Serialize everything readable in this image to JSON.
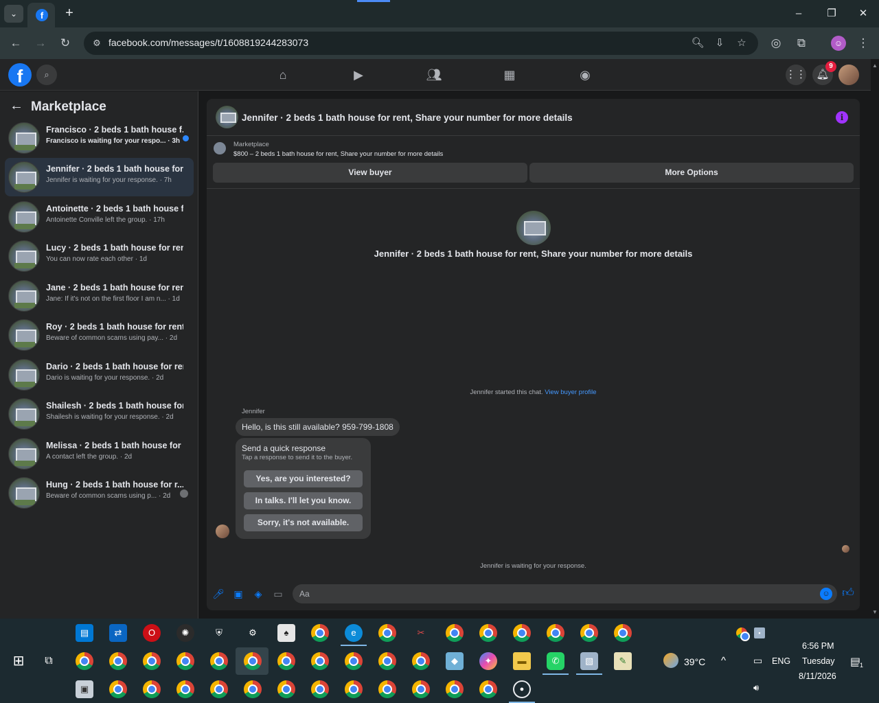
{
  "browser": {
    "url": "facebook.com/messages/t/1608819244283073",
    "new_tab_label": "+",
    "profile_initial": "☺"
  },
  "fbnav": {
    "notification_count": "9"
  },
  "sidebar": {
    "title": "Marketplace",
    "conversations": [
      {
        "title": "Francisco · 2 beds 1 bath house f...",
        "subtitle": "Francisco is waiting for your respo... · 3h",
        "unread": true
      },
      {
        "title": "Jennifer · 2 beds 1 bath house for r...",
        "subtitle": "Jennifer is waiting for your response. · 7h",
        "active": true
      },
      {
        "title": "Antoinette · 2 beds 1 bath house f...",
        "subtitle": "Antoinette Conville left the group. · 17h"
      },
      {
        "title": "Lucy · 2 beds 1 bath house for rent...",
        "subtitle": "You can now rate each other · 1d"
      },
      {
        "title": "Jane · 2 beds 1 bath house for rent...",
        "subtitle": "Jane: If it's not on the first floor I am n... · 1d"
      },
      {
        "title": "Roy · 2 beds 1 bath house for rent, ...",
        "subtitle": "Beware of common scams using pay... · 2d"
      },
      {
        "title": "Dario · 2 beds 1 bath house for ren...",
        "subtitle": "Dario is waiting for your response. · 2d"
      },
      {
        "title": "Shailesh · 2 beds 1 bath house for ...",
        "subtitle": "Shailesh is waiting for your response. · 2d"
      },
      {
        "title": "Melissa · 2 beds 1 bath house for r...",
        "subtitle": "A contact left the group. · 2d"
      },
      {
        "title": "Hung · 2 beds 1 bath house for r...",
        "subtitle": "Beware of common scams using p... · 2d"
      }
    ]
  },
  "chat": {
    "header_title": "Jennifer · 2 beds 1 bath house for rent, Share your number for more details",
    "listing_label": "Marketplace",
    "listing_price": "$800 – 2 beds 1 bath house for rent, Share your number for more details",
    "view_buyer_label": "View buyer",
    "more_options_label": "More Options",
    "center_title": "Jennifer · 2 beds 1 bath house for rent, Share your number for more details",
    "started_text": "Jennifer started this chat.",
    "view_profile_link": "View buyer profile",
    "sender_name": "Jennifer",
    "message": "Hello, is this still available? 959-799-1808",
    "quick_title": "Send a quick response",
    "quick_sub": "Tap a response to send it to the buyer.",
    "quick_responses": [
      "Yes, are you interested?",
      "In talks. I'll let you know.",
      "Sorry, it's not available."
    ],
    "waiting_text": "Jennifer is waiting for your response.",
    "composer_placeholder": "Aa"
  },
  "taskbar": {
    "weather": "39°C",
    "language": "ENG",
    "time": "6:56 PM",
    "day": "Tuesday",
    "date": "8/11/2026",
    "notification_count": "1"
  },
  "colors": {
    "accent": "#0a7cff",
    "fb_blue": "#1877f2",
    "badge_red": "#e41e3f",
    "info_purple": "#a033ff"
  }
}
